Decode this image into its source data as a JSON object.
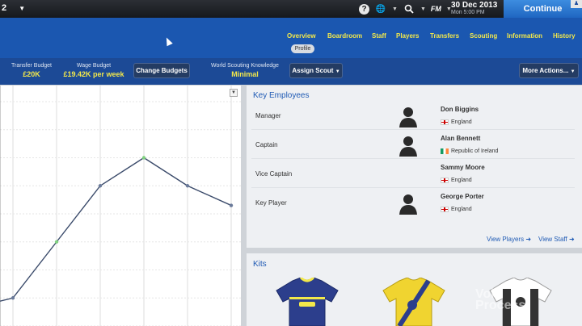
{
  "topbar": {
    "left_text": "2",
    "help_icon": "help-icon",
    "globe_icon": "globe-icon",
    "search_icon": "search-icon",
    "fm_label": "FM",
    "date": "30 Dec 2013",
    "time": "Mon 5:00 PM",
    "continue_label": "Continue"
  },
  "nav": {
    "items": [
      "Overview",
      "Boardroom",
      "Staff",
      "Players",
      "Transfers",
      "Scouting",
      "Information",
      "History"
    ],
    "active": "Overview",
    "sub_tab": "Profile"
  },
  "budgets": {
    "transfer_label": "Transfer Budget",
    "transfer_value": "£20K",
    "wage_label": "Wage Budget",
    "wage_value": "£19.42K per week",
    "change_button": "Change Budgets",
    "scouting_label": "World Scouting Knowledge",
    "scouting_value": "Minimal",
    "assign_button": "Assign Scout",
    "more_button": "More Actions..."
  },
  "chart_data": {
    "type": "line",
    "values": [
      1,
      3,
      5,
      6,
      5,
      4.3
    ],
    "ylim": [
      0,
      8
    ]
  },
  "key_employees": {
    "title": "Key Employees",
    "rows": [
      {
        "role": "Manager",
        "name": "Don Biggins",
        "nation": "England",
        "flag": "england"
      },
      {
        "role": "Captain",
        "name": "Alan Bennett",
        "nation": "Republic of Ireland",
        "flag": "ireland"
      },
      {
        "role": "Vice Captain",
        "name": "Sammy Moore",
        "nation": "England",
        "flag": "england"
      },
      {
        "role": "Key Player",
        "name": "George Porter",
        "nation": "England",
        "flag": "england"
      }
    ],
    "view_players": "View Players",
    "view_staff": "View Staff"
  },
  "kits": {
    "title": "Kits",
    "colors": {
      "home": "#2c3e8c",
      "away": "#f0d430",
      "third": "#ffffff"
    }
  },
  "watermark": {
    "line1": "Voki",
    "line2": "Process"
  }
}
